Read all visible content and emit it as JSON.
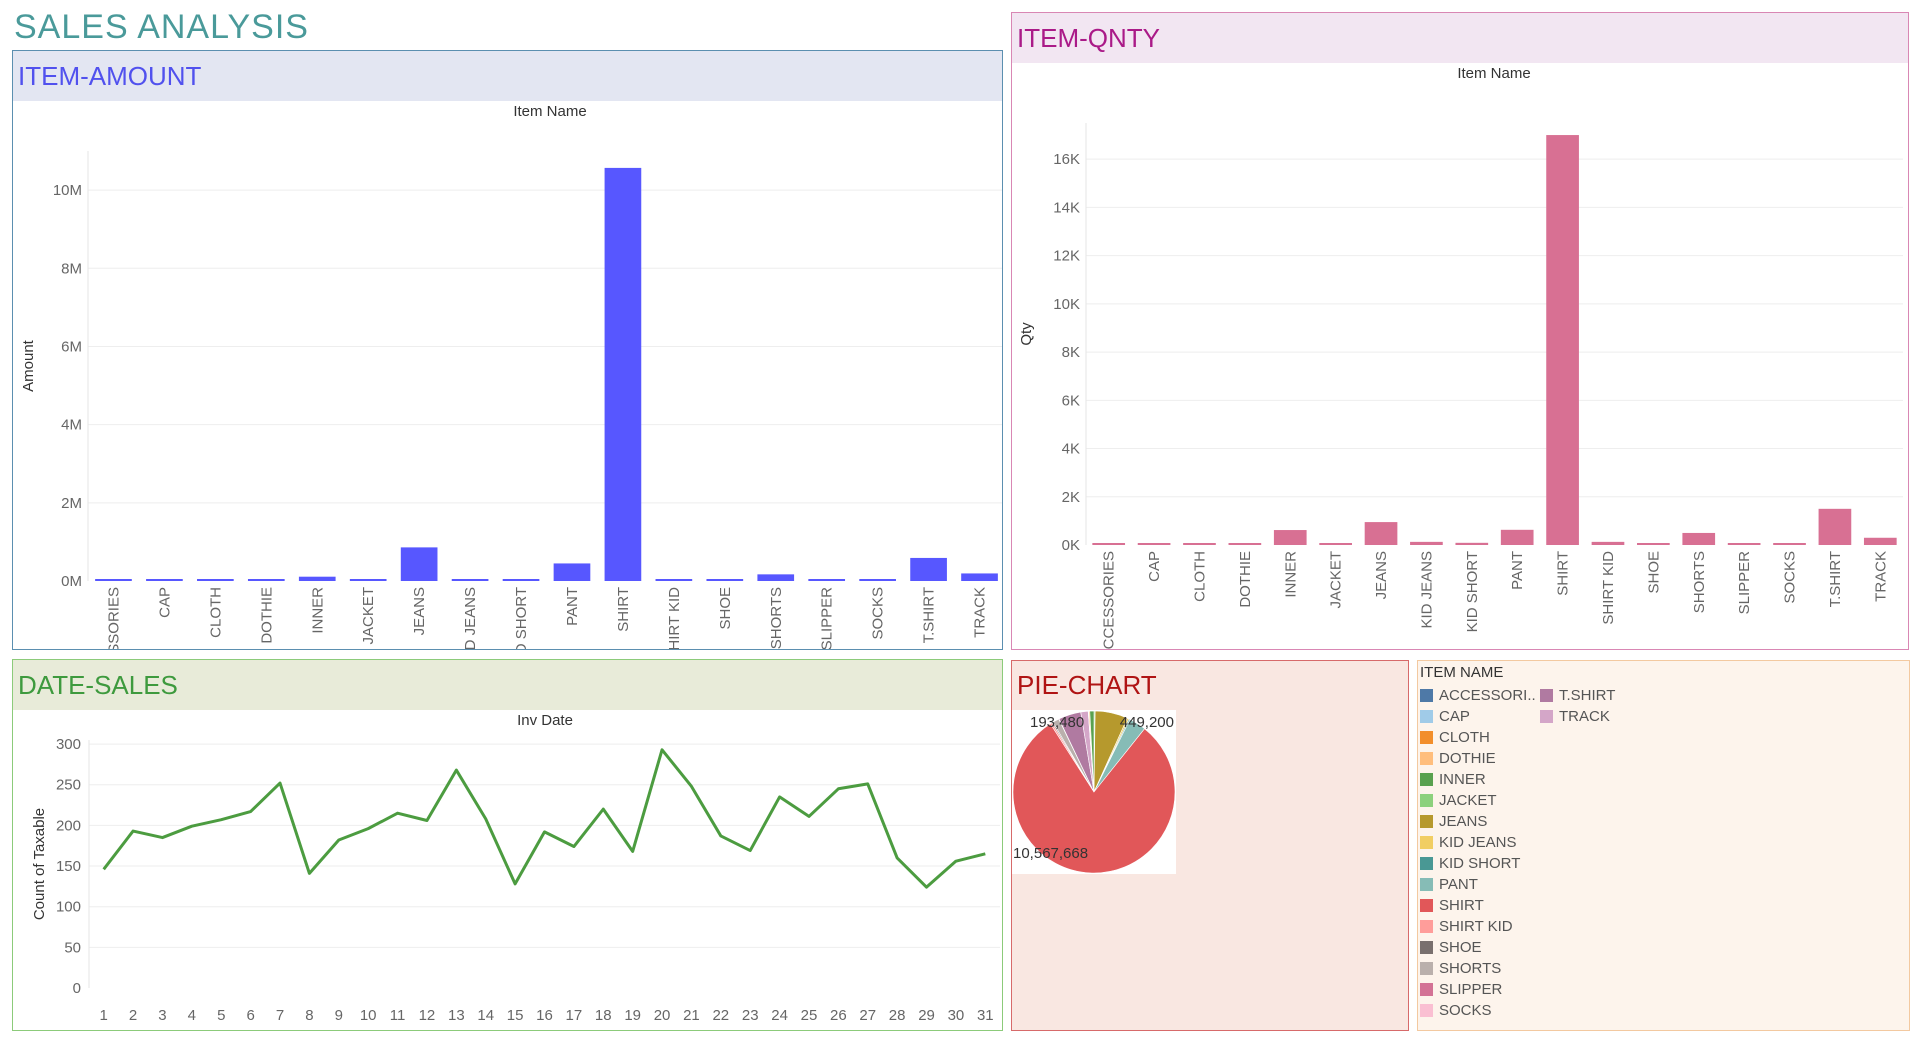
{
  "dashboard_title": "SALES ANALYSIS",
  "colors": {
    "amount_bar": "#5757ff",
    "qty_bar": "#d87093",
    "line": "#4c9c40",
    "item_amount_header_bg": "#e3e6f2",
    "item_qnty_header_bg": "#f2e6f2",
    "date_sales_header_bg": "#e8ebd9",
    "pie_panel_bg": "#f9e7e1"
  },
  "panels": {
    "item_amount": {
      "title": "ITEM-AMOUNT"
    },
    "item_qnty": {
      "title": "ITEM-QNTY"
    },
    "date_sales": {
      "title": "DATE-SALES"
    },
    "pie": {
      "title": "PIE-CHART"
    }
  },
  "legend": {
    "title": "ITEM NAME",
    "items": [
      {
        "label": "ACCESSORI..",
        "color": "#4e79a7"
      },
      {
        "label": "CAP",
        "color": "#a0cbe8"
      },
      {
        "label": "CLOTH",
        "color": "#f28e2b"
      },
      {
        "label": "DOTHIE",
        "color": "#ffbe7d"
      },
      {
        "label": "INNER",
        "color": "#59a14f"
      },
      {
        "label": "JACKET",
        "color": "#8cd17d"
      },
      {
        "label": "JEANS",
        "color": "#b6992d"
      },
      {
        "label": "KID JEANS",
        "color": "#f1ce63"
      },
      {
        "label": "KID SHORT",
        "color": "#499894"
      },
      {
        "label": "PANT",
        "color": "#86bcb6"
      },
      {
        "label": "SHIRT",
        "color": "#e15759"
      },
      {
        "label": "SHIRT KID",
        "color": "#ff9d9a"
      },
      {
        "label": "SHOE",
        "color": "#79706e"
      },
      {
        "label": "SHORTS",
        "color": "#bab0ac"
      },
      {
        "label": "SLIPPER",
        "color": "#d37295"
      },
      {
        "label": "SOCKS",
        "color": "#fabfd2"
      },
      {
        "label": "T.SHIRT",
        "color": "#b07aa1"
      },
      {
        "label": "TRACK",
        "color": "#d4a6c8"
      }
    ]
  },
  "chart_data": [
    {
      "id": "item_amount",
      "type": "bar",
      "title": "Item Name",
      "xlabel": "",
      "ylabel": "Amount",
      "ylim": [
        0,
        11000000
      ],
      "yticks": [
        0,
        2000000,
        4000000,
        6000000,
        8000000,
        10000000
      ],
      "ytick_labels": [
        "0M",
        "2M",
        "4M",
        "6M",
        "8M",
        "10M"
      ],
      "grid": true,
      "categories": [
        "ACCESSORIES",
        "CAP",
        "CLOTH",
        "DOTHIE",
        "INNER",
        "JACKET",
        "JEANS",
        "KID JEANS",
        "KID SHORT",
        "PANT",
        "SHIRT",
        "SHIRT KID",
        "SHOE",
        "SHORTS",
        "SLIPPER",
        "SOCKS",
        "T.SHIRT",
        "TRACK"
      ],
      "values": [
        5000,
        2000,
        4000,
        30000,
        110000,
        30000,
        860000,
        45000,
        30000,
        449200,
        10567668,
        50000,
        30000,
        170000,
        3000,
        5000,
        590000,
        193480
      ]
    },
    {
      "id": "item_qnty",
      "type": "bar",
      "title": "Item Name",
      "xlabel": "",
      "ylabel": "Qty",
      "ylim": [
        0,
        17500
      ],
      "yticks": [
        0,
        2000,
        4000,
        6000,
        8000,
        10000,
        12000,
        14000,
        16000
      ],
      "ytick_labels": [
        "0K",
        "2K",
        "4K",
        "6K",
        "8K",
        "10K",
        "12K",
        "14K",
        "16K"
      ],
      "grid": true,
      "categories": [
        "ACCESSORIES",
        "CAP",
        "CLOTH",
        "DOTHIE",
        "INNER",
        "JACKET",
        "JEANS",
        "KID JEANS",
        "KID SHORT",
        "PANT",
        "SHIRT",
        "SHIRT KID",
        "SHOE",
        "SHORTS",
        "SLIPPER",
        "SOCKS",
        "T.SHIRT",
        "TRACK"
      ],
      "values": [
        40,
        5,
        40,
        60,
        620,
        60,
        950,
        130,
        90,
        630,
        17000,
        130,
        40,
        500,
        10,
        40,
        1500,
        300
      ]
    },
    {
      "id": "date_sales",
      "type": "line",
      "title": "Inv Date",
      "xlabel": "",
      "ylabel": "Count of Taxable",
      "ylim": [
        0,
        305
      ],
      "yticks": [
        0,
        50,
        100,
        150,
        200,
        250,
        300
      ],
      "grid": true,
      "x": [
        1,
        2,
        3,
        4,
        5,
        6,
        7,
        8,
        9,
        10,
        11,
        12,
        13,
        14,
        15,
        16,
        17,
        18,
        19,
        20,
        21,
        22,
        23,
        24,
        25,
        26,
        27,
        28,
        29,
        30,
        31
      ],
      "values": [
        146,
        193,
        185,
        199,
        207,
        217,
        252,
        141,
        182,
        196,
        215,
        206,
        268,
        208,
        128,
        192,
        174,
        220,
        168,
        293,
        248,
        187,
        169,
        235,
        211,
        245,
        251,
        160,
        124,
        156,
        165
      ]
    },
    {
      "id": "pie",
      "type": "pie",
      "labels": [
        "ACCESSORIES",
        "CAP",
        "CLOTH",
        "DOTHIE",
        "INNER",
        "JACKET",
        "JEANS",
        "KID JEANS",
        "KID SHORT",
        "PANT",
        "SHIRT",
        "SHIRT KID",
        "SHOE",
        "SHORTS",
        "SLIPPER",
        "SOCKS",
        "T.SHIRT",
        "TRACK"
      ],
      "values": [
        5000,
        2000,
        4000,
        30000,
        110000,
        30000,
        860000,
        45000,
        30000,
        449200,
        10567668,
        50000,
        30000,
        170000,
        3000,
        5000,
        590000,
        193480
      ],
      "data_labels": [
        "193,480",
        "449,200",
        "10,567,668"
      ]
    }
  ]
}
